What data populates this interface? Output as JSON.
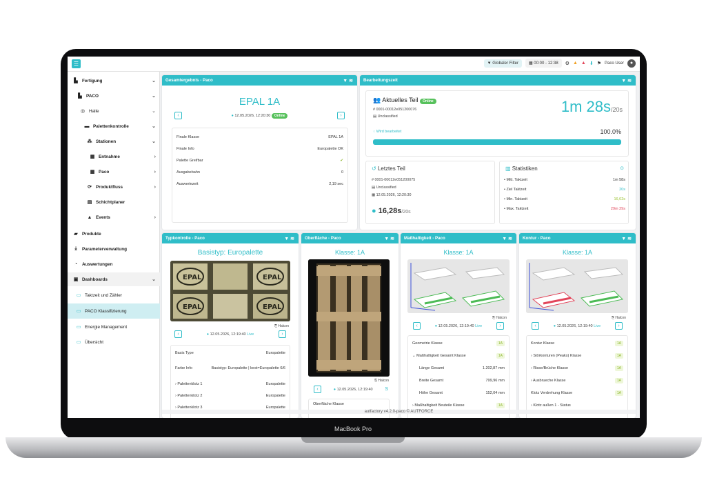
{
  "topbar": {
    "filter": "Globaler Filter",
    "time_range": "00:00 - 12:38",
    "user": "Paco User"
  },
  "sidebar": {
    "items": [
      {
        "label": "Fertigung",
        "icon": "factory-icon"
      },
      {
        "label": "PACO",
        "icon": "factory-icon"
      },
      {
        "label": "Halle",
        "icon": "target-icon"
      },
      {
        "label": "Palettenkontrolle",
        "icon": "line-icon"
      },
      {
        "label": "Stationen",
        "icon": "network-icon"
      },
      {
        "label": "Entnahme",
        "icon": "box-icon"
      },
      {
        "label": "Paco",
        "icon": "box-icon"
      },
      {
        "label": "Produktfluss",
        "icon": "sync-icon"
      },
      {
        "label": "Schichtplaner",
        "icon": "calendar-icon"
      },
      {
        "label": "Events",
        "icon": "warning-icon"
      },
      {
        "label": "Produkte",
        "icon": "truck-icon"
      },
      {
        "label": "Parameterverwaltung",
        "icon": "download-icon"
      },
      {
        "label": "Auswertungen",
        "icon": "pie-icon"
      },
      {
        "label": "Dashboards",
        "icon": "dashboard-icon"
      },
      {
        "label": "Taktzeit und Zähler",
        "icon": "monitor-icon"
      },
      {
        "label": "PACO Klassifizierung",
        "icon": "monitor-icon"
      },
      {
        "label": "Energie Management",
        "icon": "monitor-icon"
      },
      {
        "label": "Übersicht",
        "icon": "monitor-icon"
      }
    ]
  },
  "gesamt": {
    "header": "Gesamtergebnis - Paco",
    "title": "EPAL 1A",
    "timestamp": "12.05.2026, 12:20:30",
    "status": "Online",
    "rows": [
      [
        "Finale Klasse",
        "EPAL 1A"
      ],
      [
        "Finale Info",
        "Europalette OK"
      ],
      [
        "Palette Greifbar",
        "✔"
      ],
      [
        "Ausgabebahn",
        "0"
      ],
      [
        "Auswertezeit",
        "2,19 sec"
      ]
    ]
  },
  "bearbeitung": {
    "header": "Bearbeitungszeit",
    "current_label": "Aktuelles Teil",
    "status": "Online",
    "id": "0001-00012e051200076",
    "class": "Unclassified",
    "progress_text": "Wird bearbeitet",
    "time": "1m 28s",
    "time_target": "/20s",
    "percent": "100.0%",
    "progress": 1.0
  },
  "letztes": {
    "label": "Letztes Teil",
    "id": "0001-00012e051200075",
    "class": "Unclassified",
    "timestamp": "12.05.2026, 12:20:30",
    "time": "16,28s",
    "time_target": "/20s"
  },
  "statistiken": {
    "label": "Statistiken",
    "rows": [
      [
        "Mitt. Taktzeit",
        "1m 58s",
        "#333"
      ],
      [
        "Ziel Taktzeit",
        "20s",
        "#2fbdc8"
      ],
      [
        "Min. Taktzeit",
        "16,02s",
        "#9ac22f"
      ],
      [
        "Max. Taktzeit",
        "29m 29s",
        "#e2455a"
      ]
    ]
  },
  "typkontrolle": {
    "header": "Typkontrolle - Paco",
    "title": "Basistyp:  Europalette",
    "source": "Halcon",
    "timestamp": "12.05.2026, 12:19:40",
    "live": "Live",
    "rows": [
      [
        "Basis Type",
        "Europalette"
      ],
      [
        "Farbe Info",
        "Basistyp: Europalette | best=Europalette 6/6"
      ],
      [
        "Palettenklotz 1",
        "Europalette"
      ],
      [
        "Palettenklotz 2",
        "Europalette"
      ],
      [
        "Palettenklotz 3",
        "Europalette"
      ]
    ]
  },
  "oberflaeche": {
    "header": "Oberfläche - Paco",
    "title": "Klasse:   1A",
    "source": "Halcon",
    "timestamp": "12.05.2026, 12:19:40",
    "cut": "Oberfläche Klasse"
  },
  "masshaltigkeit": {
    "header": "Maßhaltigkeit - Paco",
    "title": "Klasse:   1A",
    "source": "Halcon",
    "timestamp": "12.05.2026, 12:19:40",
    "live": "Live",
    "rows": [
      [
        "Geometrie Klasse",
        "1A"
      ],
      [
        "Maßhaltigkeit Gesamt Klasse",
        "1A"
      ],
      [
        "Länge Gesamt",
        "1.202,87 mm"
      ],
      [
        "Breite Gesamt",
        "799,96 mm"
      ],
      [
        "Höhe Gesamt",
        "152,04 mm"
      ],
      [
        "Maßhaltigkeit Beuteile Klasse",
        "1A"
      ]
    ]
  },
  "kontur": {
    "header": "Kontur - Paco",
    "title": "Klasse:   1A",
    "source": "Halcon",
    "timestamp": "12.05.2026, 12:19:40",
    "live": "Live",
    "rows": [
      [
        "Kontur Klasse",
        "1A"
      ],
      [
        "Störkonturen (Peaks) Klasse",
        "1A"
      ],
      [
        "Risse/Brüche Klasse",
        "1A"
      ],
      [
        "Ausbrueche Klasse",
        "1A"
      ],
      [
        "Klotz Verdrehung Klasse",
        "1A"
      ],
      [
        "Klotz außen 1 - Status",
        ""
      ]
    ]
  },
  "footer": "autfactory v4.2.0-paco © AUTFORCE",
  "device": "MacBook Pro",
  "colors": {
    "accent": "#2fbdc8",
    "online": "#57c15c"
  }
}
